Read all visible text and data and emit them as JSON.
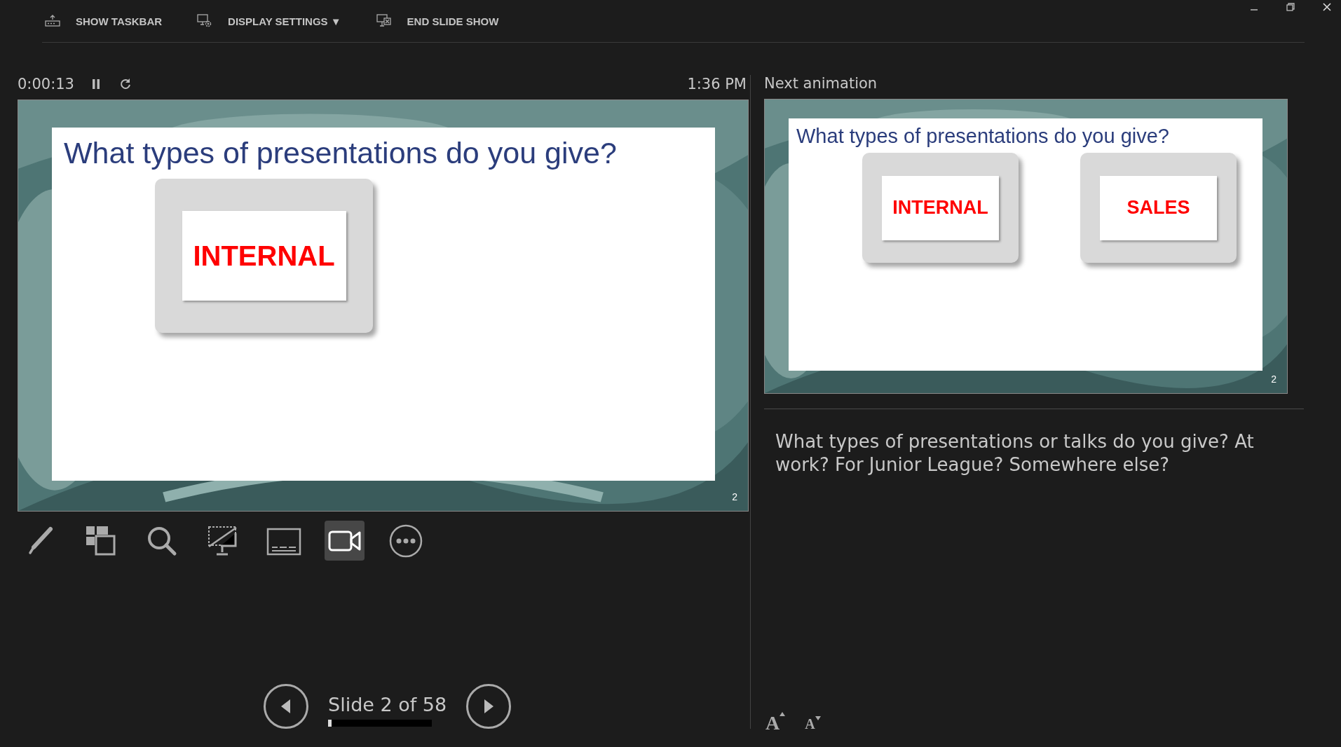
{
  "toolbar": [
    {
      "kind": "taskbar",
      "label": "SHOW TASKBAR"
    },
    {
      "kind": "display",
      "label": "DISPLAY SETTINGS ▼"
    },
    {
      "kind": "end",
      "label": "END SLIDE SHOW"
    }
  ],
  "timer": {
    "elapsed": "0:00:13",
    "paused": false,
    "clock": "1:36 PM"
  },
  "current_slide": {
    "title": "What types of presentations do you give?",
    "cards": [
      "INTERNAL"
    ],
    "number": "2"
  },
  "next": {
    "heading": "Next animation",
    "title": "What types of presentations do you give?",
    "cards": [
      "INTERNAL",
      "SALES"
    ],
    "number": "2"
  },
  "notes": "What types of presentations or talks do you give? At work? For Junior League? Somewhere else?",
  "tools": [
    {
      "kind": "pen",
      "selected": false
    },
    {
      "kind": "slides",
      "selected": false
    },
    {
      "kind": "zoom",
      "selected": false
    },
    {
      "kind": "screen",
      "selected": false
    },
    {
      "kind": "subtitles",
      "selected": false
    },
    {
      "kind": "camera",
      "selected": true
    },
    {
      "kind": "more",
      "selected": false
    }
  ],
  "navigation": {
    "label": "Slide 2 of 58",
    "level": 0.034
  },
  "font_buttons": [
    {
      "kind": "increase",
      "label": "A"
    },
    {
      "kind": "decrease",
      "label": "A"
    }
  ]
}
